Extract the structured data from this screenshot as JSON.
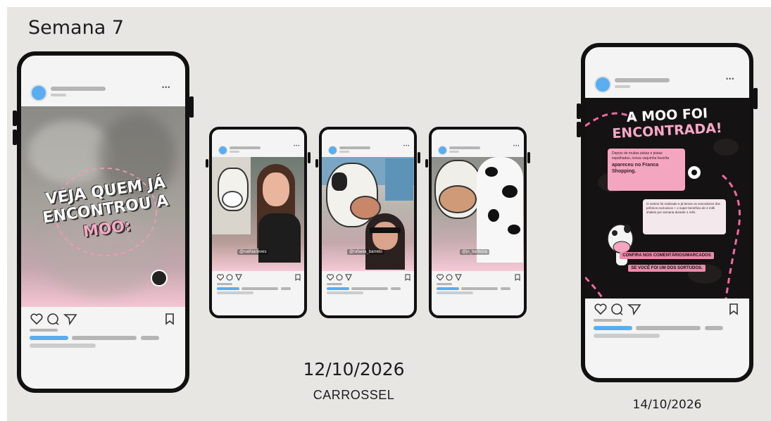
{
  "header": {
    "week_title": "Semana 7"
  },
  "post1": {
    "headline_1": "VEJA QUEM JÁ",
    "headline_2": "ENCONTROU A",
    "headline_3": "MOO:"
  },
  "carousel": {
    "slides": [
      {
        "tag": "@nathianeves"
      },
      {
        "tag": "@rafaela_barreto"
      },
      {
        "tag": "@jo_barbosa"
      }
    ],
    "date": "12/10/2026",
    "label": "CARROSSEL"
  },
  "post2": {
    "title_1": "A MOO FOI",
    "title_2": "ENCONTRADA!",
    "box1_text": "Depois de muitas pistas e pistas espalhadas, nossa vaquinha favorita",
    "box1_bold": "apareceu no Franca Shopping.",
    "box2_text": "O sorteio foi realizado e já temos os vencedores dos prêmios exclusivos + o super benefício de 2 milk shakes por semana durante 1 mês.",
    "cta_1": "CONFIRA NOS COMENTÁRIOS/MARCADOS",
    "cta_2": "SE VOCÊ FOI UM DOS SORTUDOS.",
    "date": "14/10/2026"
  },
  "colors": {
    "pink": "#f3a6c2",
    "hot_pink": "#ff6fa8",
    "blue_bar": "#5aaef0",
    "dark_bg": "#141212"
  }
}
